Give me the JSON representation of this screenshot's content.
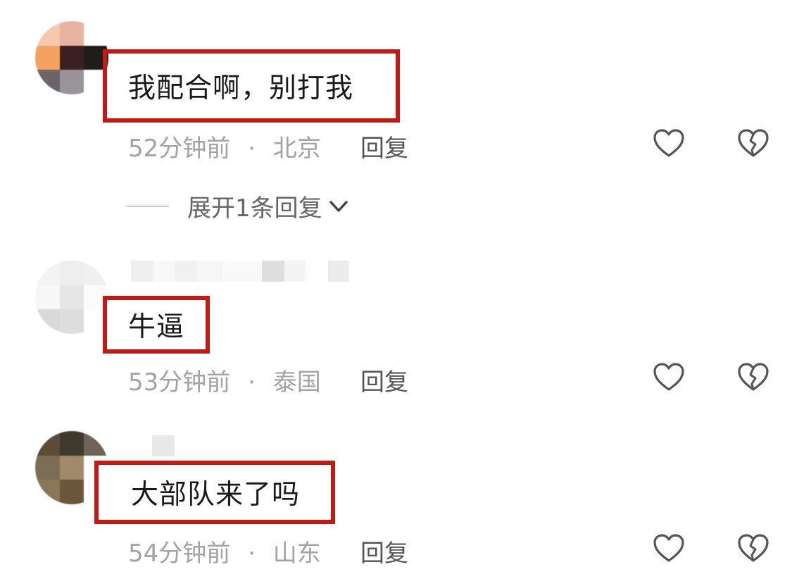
{
  "comments": [
    {
      "text": "我配合啊，别打我",
      "time": "52分钟前",
      "separator": "·",
      "location": "北京",
      "reply_label": "回复"
    },
    {
      "text": "牛逼",
      "time": "53分钟前",
      "separator": "·",
      "location": "泰国",
      "reply_label": "回复"
    },
    {
      "text": "大部队来了吗",
      "time": "54分钟前",
      "separator": "·",
      "location": "山东",
      "reply_label": "回复"
    }
  ],
  "expand_replies": {
    "label": "展开1条回复"
  },
  "colors": {
    "highlight_border": "#c41a14",
    "meta_text": "#a3a3a3",
    "reply_text": "#555555",
    "icon_stroke": "#555555"
  },
  "icons": [
    "heart-icon",
    "broken-heart-icon",
    "chevron-down-icon"
  ]
}
